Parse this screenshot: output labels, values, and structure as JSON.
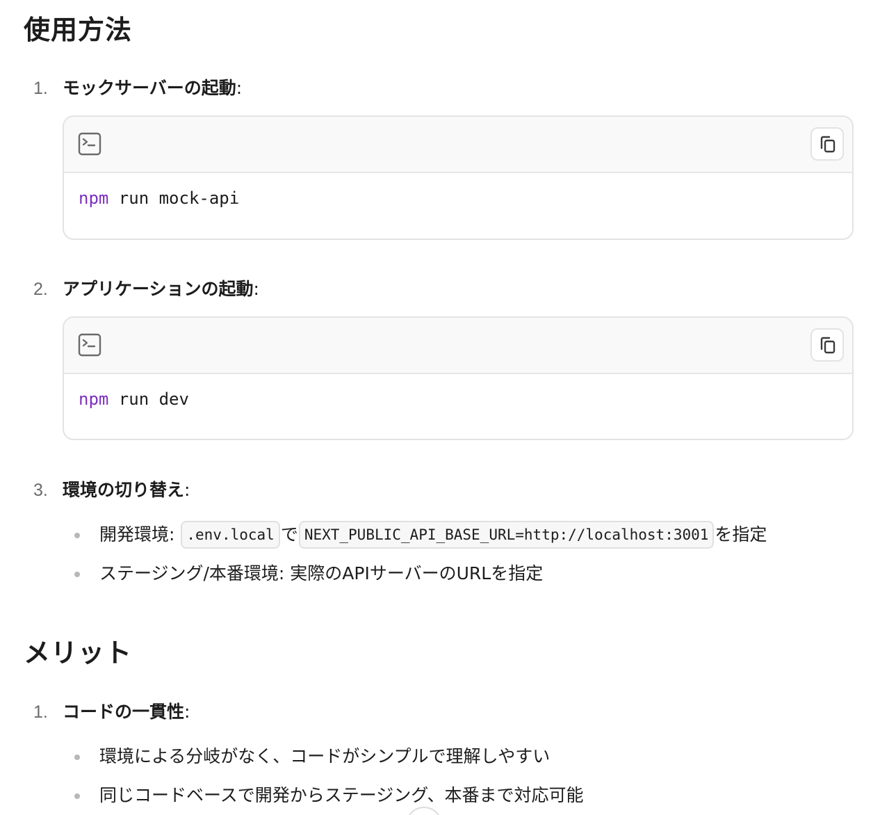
{
  "usage": {
    "heading": "使用方法",
    "steps": [
      {
        "num": "1.",
        "label": "モックサーバーの起動",
        "colon": ":",
        "code_cmd": "npm",
        "code_rest": " run mock-api"
      },
      {
        "num": "2.",
        "label": "アプリケーションの起動",
        "colon": ":",
        "code_cmd": "npm",
        "code_rest": " run dev"
      },
      {
        "num": "3.",
        "label": "環境の切り替え",
        "colon": ":"
      }
    ],
    "bullets": [
      {
        "prefix": "開発環境: ",
        "code1": ".env.local",
        "mid": "で",
        "code2": "NEXT_PUBLIC_API_BASE_URL=http://localhost:3001",
        "suffix": "を指定"
      },
      {
        "text": "ステージング/本番環境: 実際のAPIサーバーのURLを指定"
      }
    ]
  },
  "merits": {
    "heading": "メリット",
    "steps": [
      {
        "num": "1.",
        "label": "コードの一貫性",
        "colon": ":"
      }
    ],
    "bullets": [
      {
        "text": "環境による分岐がなく、コードがシンプルで理解しやすい"
      },
      {
        "text": "同じコードベースで開発からステージング、本番まで対応可能"
      }
    ]
  },
  "icons": {
    "terminal": "terminal-icon",
    "copy": "copy-icon"
  },
  "colors": {
    "command_keyword": "#7b2fbf",
    "code_header_bg": "#f9f9f9",
    "border": "#e3e3e3"
  }
}
